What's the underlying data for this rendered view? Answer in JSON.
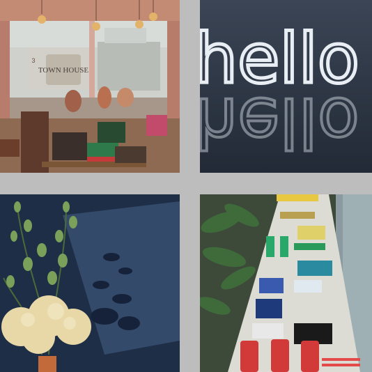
{
  "grid": {
    "tiles": [
      {
        "name": "shop-interior",
        "sign_text": "TOWN HOUSE",
        "sign_number": "3"
      },
      {
        "name": "neon-hello",
        "neon_text": "hello"
      },
      {
        "name": "flowers-shadow"
      },
      {
        "name": "stationery-display"
      }
    ]
  }
}
